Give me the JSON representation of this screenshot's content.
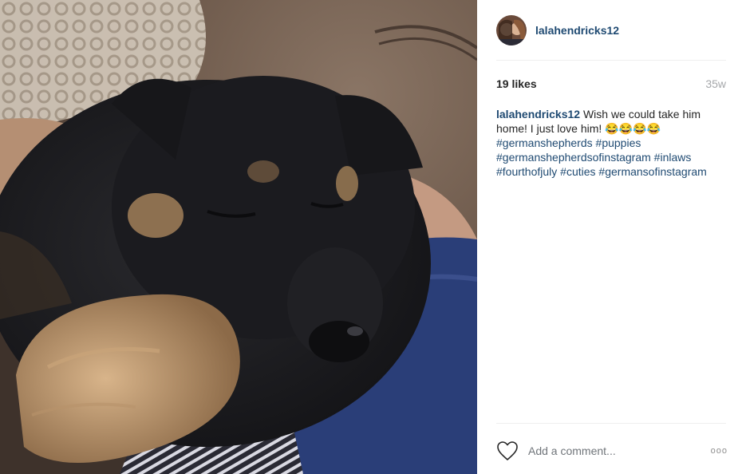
{
  "post": {
    "username": "lalahendricks12",
    "likes": "19 likes",
    "age": "35w"
  },
  "caption": {
    "author": "lalahendricks12",
    "text": " Wish we could take him home! I just love him! ",
    "emoji": "😂😂😂😂",
    "hashtags": [
      "#germanshepherds",
      "#puppies",
      "#germanshepherdsofinstagram",
      "#inlaws",
      "#fourthofjuly",
      "#cuties",
      "#germansofinstagram"
    ]
  },
  "comment": {
    "placeholder": "Add a comment...",
    "more_label": "ooo"
  },
  "icons": {
    "like": "heart-icon",
    "more": "more-options-icon"
  },
  "colors": {
    "link": "#1f4a72",
    "muted": "#a5a7aa",
    "divider": "#efefef"
  }
}
